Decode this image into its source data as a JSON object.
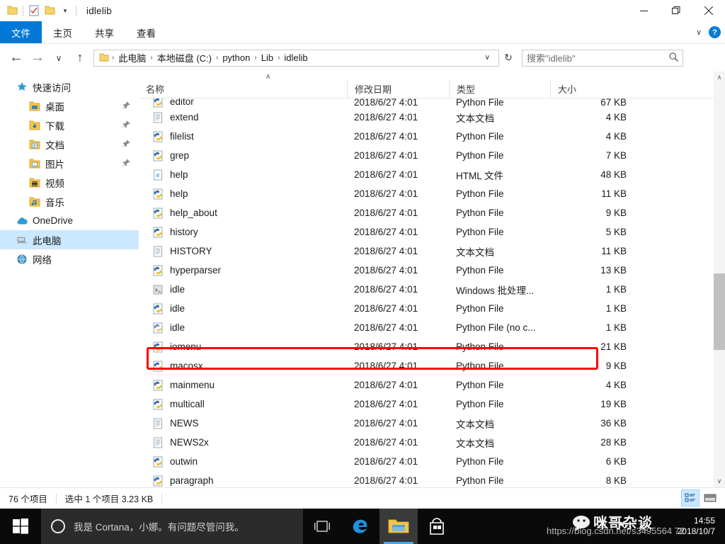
{
  "window": {
    "title": "idlelib",
    "quick_access": [
      {
        "name": "folder-icon"
      },
      {
        "name": "properties-icon"
      },
      {
        "name": "new-folder-icon"
      },
      {
        "name": "customize-qat-chevron-icon"
      }
    ],
    "controls": {
      "minimize": "—",
      "maximize": "❐",
      "close": "✕"
    }
  },
  "ribbon": {
    "tabs": [
      {
        "label": "文件",
        "active": true
      },
      {
        "label": "主页",
        "active": false
      },
      {
        "label": "共享",
        "active": false
      },
      {
        "label": "查看",
        "active": false
      }
    ],
    "collapse_chevron": "∨",
    "help_label": "?"
  },
  "address_bar": {
    "back_icon": "←",
    "forward_icon": "→",
    "history_icon": "∨",
    "up_icon": "↑",
    "breadcrumbs": [
      "此电脑",
      "本地磁盘 (C:)",
      "python",
      "Lib",
      "idlelib"
    ],
    "separator": "›",
    "dropdown_chevron": "∨",
    "refresh_icon": "↻"
  },
  "search": {
    "placeholder": "搜索\"idlelib\"",
    "icon": "⚲"
  },
  "sidebar": {
    "items": [
      {
        "label": "快速访问",
        "icon": "star-icon",
        "level": 0,
        "pinned": false,
        "selected": false
      },
      {
        "label": "桌面",
        "icon": "desktop-folder-icon",
        "level": 1,
        "pinned": true,
        "selected": false
      },
      {
        "label": "下载",
        "icon": "downloads-folder-icon",
        "level": 1,
        "pinned": true,
        "selected": false
      },
      {
        "label": "文档",
        "icon": "documents-folder-icon",
        "level": 1,
        "pinned": true,
        "selected": false
      },
      {
        "label": "图片",
        "icon": "pictures-folder-icon",
        "level": 1,
        "pinned": true,
        "selected": false
      },
      {
        "label": "视频",
        "icon": "videos-folder-icon",
        "level": 1,
        "pinned": false,
        "selected": false
      },
      {
        "label": "音乐",
        "icon": "music-folder-icon",
        "level": 1,
        "pinned": false,
        "selected": false
      },
      {
        "label": "OneDrive",
        "icon": "onedrive-cloud-icon",
        "level": 0,
        "pinned": false,
        "selected": false
      },
      {
        "label": "此电脑",
        "icon": "this-pc-icon",
        "level": 0,
        "pinned": false,
        "selected": true
      },
      {
        "label": "网络",
        "icon": "network-icon",
        "level": 0,
        "pinned": false,
        "selected": false
      }
    ]
  },
  "file_list": {
    "columns": [
      {
        "label": "名称",
        "key": "name"
      },
      {
        "label": "修改日期",
        "key": "date"
      },
      {
        "label": "类型",
        "key": "type"
      },
      {
        "label": "大小",
        "key": "size"
      }
    ],
    "sort_caret": "∧",
    "rows": [
      {
        "name": "editor",
        "date": "2018/6/27 4:01",
        "type": "Python File",
        "size": "67 KB",
        "icon": "python-file-icon",
        "clipped": true,
        "selected": false
      },
      {
        "name": "extend",
        "date": "2018/6/27 4:01",
        "type": "文本文档",
        "size": "4 KB",
        "icon": "text-file-icon",
        "clipped": false,
        "selected": false
      },
      {
        "name": "filelist",
        "date": "2018/6/27 4:01",
        "type": "Python File",
        "size": "4 KB",
        "icon": "python-file-icon",
        "clipped": false,
        "selected": false
      },
      {
        "name": "grep",
        "date": "2018/6/27 4:01",
        "type": "Python File",
        "size": "7 KB",
        "icon": "python-file-icon",
        "clipped": false,
        "selected": false
      },
      {
        "name": "help",
        "date": "2018/6/27 4:01",
        "type": "HTML 文件",
        "size": "48 KB",
        "icon": "html-file-icon",
        "clipped": false,
        "selected": false
      },
      {
        "name": "help",
        "date": "2018/6/27 4:01",
        "type": "Python File",
        "size": "11 KB",
        "icon": "python-file-icon",
        "clipped": false,
        "selected": false
      },
      {
        "name": "help_about",
        "date": "2018/6/27 4:01",
        "type": "Python File",
        "size": "9 KB",
        "icon": "python-file-icon",
        "clipped": false,
        "selected": false
      },
      {
        "name": "history",
        "date": "2018/6/27 4:01",
        "type": "Python File",
        "size": "5 KB",
        "icon": "python-file-icon",
        "clipped": false,
        "selected": false
      },
      {
        "name": "HISTORY",
        "date": "2018/6/27 4:01",
        "type": "文本文档",
        "size": "11 KB",
        "icon": "text-file-icon",
        "clipped": false,
        "selected": false
      },
      {
        "name": "hyperparser",
        "date": "2018/6/27 4:01",
        "type": "Python File",
        "size": "13 KB",
        "icon": "python-file-icon",
        "clipped": false,
        "selected": false
      },
      {
        "name": "idle",
        "date": "2018/6/27 4:01",
        "type": "Windows 批处理...",
        "size": "1 KB",
        "icon": "batch-file-icon",
        "clipped": false,
        "selected": true
      },
      {
        "name": "idle",
        "date": "2018/6/27 4:01",
        "type": "Python File",
        "size": "1 KB",
        "icon": "python-file-icon",
        "clipped": false,
        "selected": false
      },
      {
        "name": "idle",
        "date": "2018/6/27 4:01",
        "type": "Python File (no c...",
        "size": "1 KB",
        "icon": "pythonw-file-icon",
        "clipped": false,
        "selected": false
      },
      {
        "name": "iomenu",
        "date": "2018/6/27 4:01",
        "type": "Python File",
        "size": "21 KB",
        "icon": "python-file-icon",
        "clipped": false,
        "selected": false
      },
      {
        "name": "macosx",
        "date": "2018/6/27 4:01",
        "type": "Python File",
        "size": "9 KB",
        "icon": "python-file-icon",
        "clipped": false,
        "selected": false
      },
      {
        "name": "mainmenu",
        "date": "2018/6/27 4:01",
        "type": "Python File",
        "size": "4 KB",
        "icon": "python-file-icon",
        "clipped": false,
        "selected": false
      },
      {
        "name": "multicall",
        "date": "2018/6/27 4:01",
        "type": "Python File",
        "size": "19 KB",
        "icon": "python-file-icon",
        "clipped": false,
        "selected": false
      },
      {
        "name": "NEWS",
        "date": "2018/6/27 4:01",
        "type": "文本文档",
        "size": "36 KB",
        "icon": "text-file-icon",
        "clipped": false,
        "selected": false
      },
      {
        "name": "NEWS2x",
        "date": "2018/6/27 4:01",
        "type": "文本文档",
        "size": "28 KB",
        "icon": "text-file-icon",
        "clipped": false,
        "selected": false
      },
      {
        "name": "outwin",
        "date": "2018/6/27 4:01",
        "type": "Python File",
        "size": "6 KB",
        "icon": "python-file-icon",
        "clipped": false,
        "selected": false
      },
      {
        "name": "paragraph",
        "date": "2018/6/27 4:01",
        "type": "Python File",
        "size": "8 KB",
        "icon": "python-file-icon",
        "clipped": false,
        "selected": false
      }
    ]
  },
  "scrollbar": {
    "up_arrow": "∧",
    "down_arrow": "∨"
  },
  "status_bar": {
    "item_count": "76 个项目",
    "selection": "选中 1 个项目  3.23 KB",
    "views": [
      {
        "name": "details-view-button",
        "active": true
      },
      {
        "name": "large-icons-view-button",
        "active": false
      }
    ]
  },
  "taskbar": {
    "start_icon": "windows-logo-icon",
    "cortana_text": "我是 Cortana，小娜。有问题尽管问我。",
    "task_view_icon": "task-view-icon",
    "pinned": [
      {
        "name": "edge-icon",
        "active": false
      },
      {
        "name": "file-explorer-icon",
        "active": true
      },
      {
        "name": "microsoft-store-icon",
        "active": false
      }
    ],
    "clock_time": "14:55",
    "clock_date": "2018/10/7"
  },
  "watermarks": {
    "url": "https://blog.csdn.net/s3495564 72",
    "brand": "咪哥杂谈"
  },
  "colors": {
    "accent": "#0078d7",
    "selection": "#cce8ff",
    "annotation": "#fe0000",
    "taskbar": "#0a0a0a"
  }
}
